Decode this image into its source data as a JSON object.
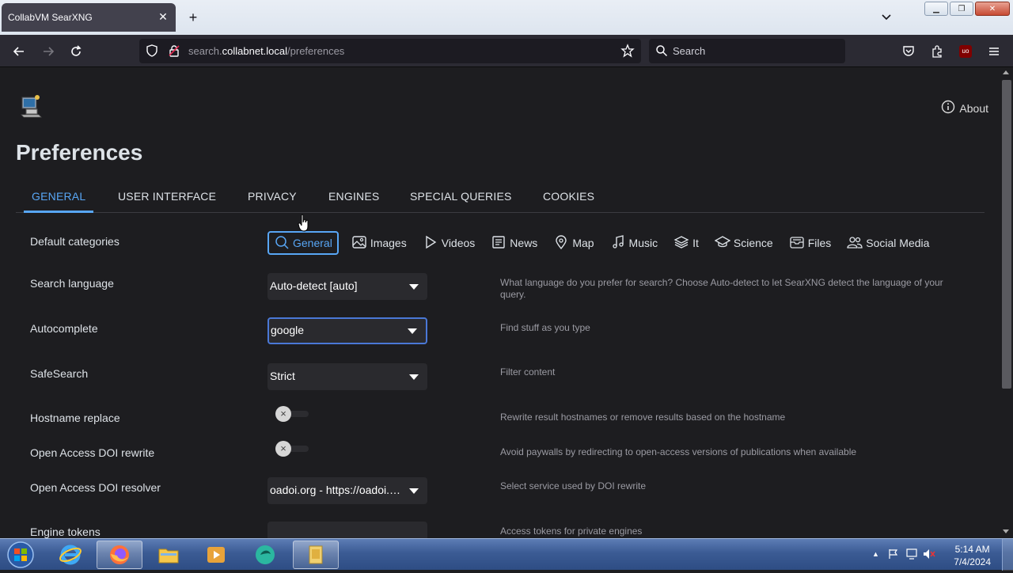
{
  "browser": {
    "tab_title": "CollabVM SearXNG",
    "url_prefix": "search.",
    "url_host": "collabnet.local",
    "url_path": "/preferences",
    "search_placeholder": "Search",
    "ublock_badge": "uo"
  },
  "page": {
    "about_label": "About",
    "title": "Preferences",
    "tabs": [
      {
        "label": "GENERAL"
      },
      {
        "label": "USER INTERFACE"
      },
      {
        "label": "PRIVACY"
      },
      {
        "label": "ENGINES"
      },
      {
        "label": "SPECIAL QUERIES"
      },
      {
        "label": "COOKIES"
      }
    ],
    "default_categories_label": "Default categories",
    "categories": [
      {
        "label": "General",
        "icon": "search-icon"
      },
      {
        "label": "Images",
        "icon": "image-icon"
      },
      {
        "label": "Videos",
        "icon": "play-icon"
      },
      {
        "label": "News",
        "icon": "newspaper-icon"
      },
      {
        "label": "Map",
        "icon": "location-pin-icon"
      },
      {
        "label": "Music",
        "icon": "music-note-icon"
      },
      {
        "label": "It",
        "icon": "layers-icon"
      },
      {
        "label": "Science",
        "icon": "graduation-cap-icon"
      },
      {
        "label": "Files",
        "icon": "file-tray-icon"
      },
      {
        "label": "Social Media",
        "icon": "people-icon"
      }
    ],
    "settings": {
      "search_language": {
        "label": "Search language",
        "value": "Auto-detect [auto]",
        "help": "What language do you prefer for search? Choose Auto-detect to let SearXNG detect the language of your query."
      },
      "autocomplete": {
        "label": "Autocomplete",
        "value": "google",
        "help": "Find stuff as you type"
      },
      "safesearch": {
        "label": "SafeSearch",
        "value": "Strict",
        "help": "Filter content"
      },
      "hostname_replace": {
        "label": "Hostname replace",
        "help": "Rewrite result hostnames or remove results based on the hostname",
        "toggle_symbol": "×"
      },
      "oa_doi_rewrite": {
        "label": "Open Access DOI rewrite",
        "help": "Avoid paywalls by redirecting to open-access versions of publications when available",
        "toggle_symbol": "×"
      },
      "oa_doi_resolver": {
        "label": "Open Access DOI resolver",
        "value": "oadoi.org - https://oadoi.org/",
        "help": "Select service used by DOI rewrite"
      },
      "engine_tokens": {
        "label": "Engine tokens",
        "help": "Access tokens for private engines"
      }
    }
  },
  "taskbar": {
    "time": "5:14 AM",
    "date": "7/4/2024"
  },
  "colors": {
    "accent": "#58a6f5",
    "page_bg": "#1d1d20",
    "toolbar_bg": "#2b2a33"
  }
}
